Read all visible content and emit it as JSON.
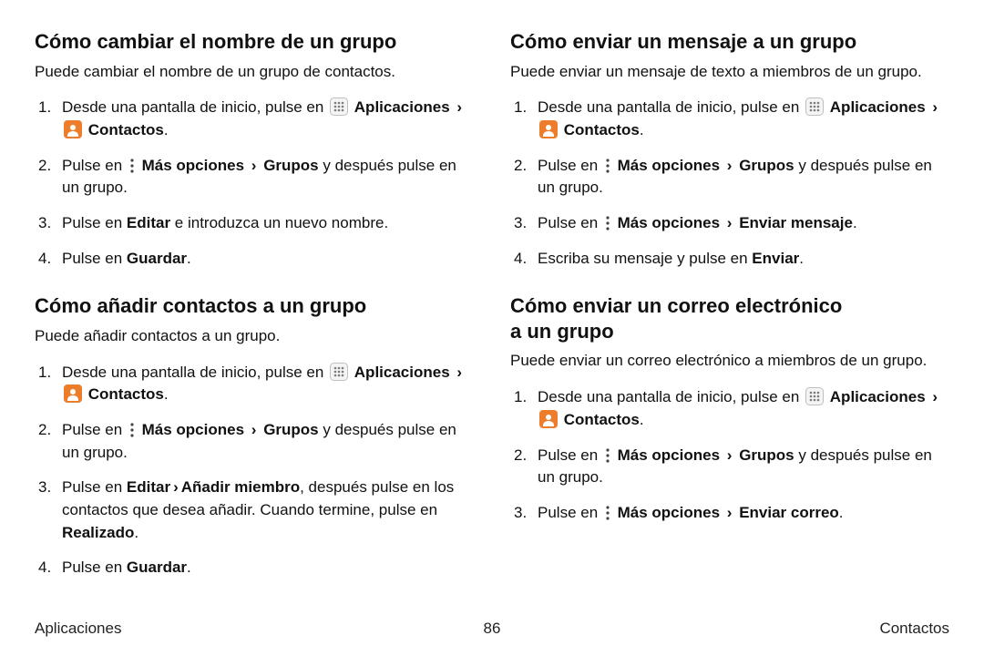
{
  "icons": {
    "apps_label": "Aplicaciones",
    "contacts_label": "Contactos",
    "more_label": "Más opciones"
  },
  "common": {
    "step1_pre": "Desde una pantalla de inicio, pulse en ",
    "step2_pre": "Pulse en ",
    "chevron": "›",
    "grupos": "Grupos",
    "step2_post": " y después pulse en un grupo.",
    "enviar_mensaje": "Enviar mensaje",
    "enviar_correo": "Enviar correo",
    "period": "."
  },
  "left": {
    "s1": {
      "title": "Cómo cambiar el nombre de un grupo",
      "intro": "Puede cambiar el nombre de un grupo de contactos.",
      "step3_pre": "Pulse en ",
      "step3_b1": "Editar",
      "step3_post": " e introduzca un nuevo nombre.",
      "step4_pre": "Pulse en ",
      "step4_b1": "Guardar"
    },
    "s2": {
      "title": "Cómo añadir contactos a un grupo",
      "intro": "Puede añadir contactos a un grupo.",
      "step3_pre": "Pulse en ",
      "step3_b1": "Editar",
      "step3_sep": " › ",
      "step3_b2": "Añadir miembro",
      "step3_post": ", después pulse en los contactos que desea añadir. Cuando termine, pulse en ",
      "step3_b3": "Realizado",
      "step4_pre": "Pulse en ",
      "step4_b1": "Guardar"
    }
  },
  "right": {
    "s1": {
      "title": "Cómo enviar un mensaje a un grupo",
      "intro": "Puede enviar un mensaje de texto a miembros de un grupo.",
      "step4_pre": "Escriba su mensaje y pulse en ",
      "step4_b1": "Enviar"
    },
    "s2": {
      "title": "Cómo enviar un correo electrónico a un grupo",
      "intro": "Puede enviar un correo electrónico a miembros de un grupo."
    }
  },
  "footer": {
    "left": "Aplicaciones",
    "center": "86",
    "right": "Contactos"
  }
}
